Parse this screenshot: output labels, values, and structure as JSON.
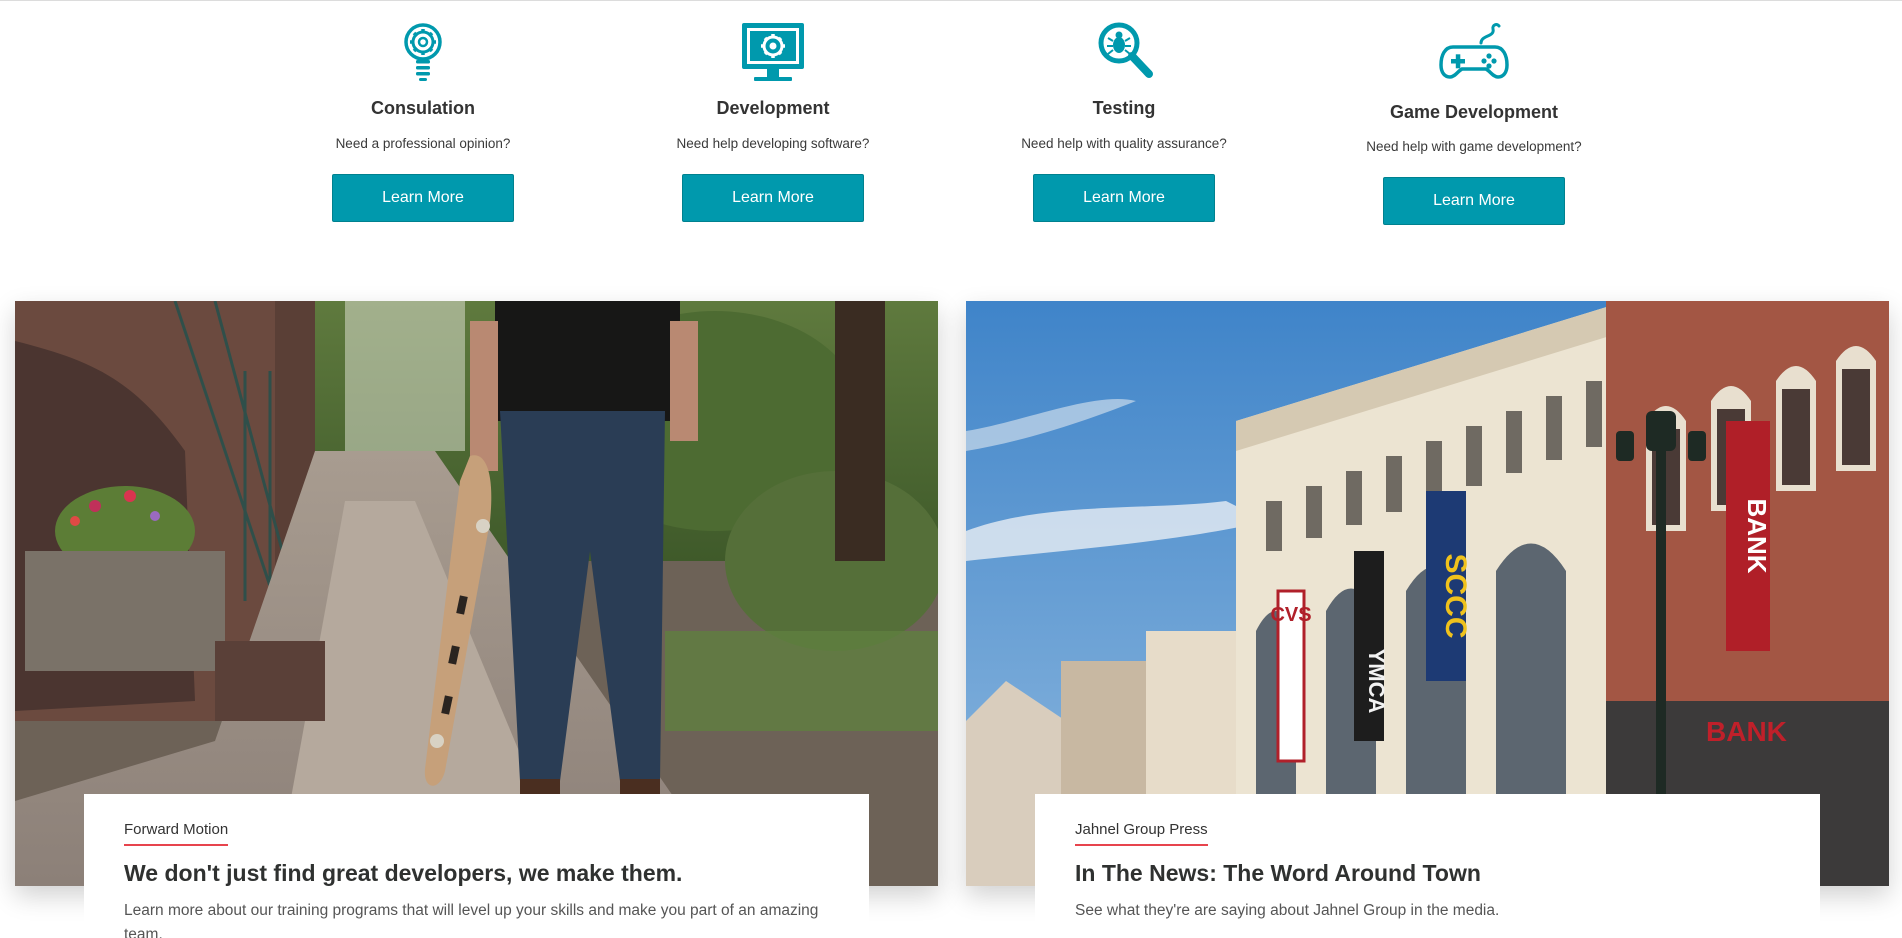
{
  "services": [
    {
      "title": "Consulation",
      "description": "Need a professional opinion?",
      "button": "Learn More",
      "icon": "lightbulb-gear-icon"
    },
    {
      "title": "Development",
      "description": "Need help developing software?",
      "button": "Learn More",
      "icon": "monitor-gear-icon"
    },
    {
      "title": "Testing",
      "description": "Need help with quality assurance?",
      "button": "Learn More",
      "icon": "magnifier-bug-icon"
    },
    {
      "title": "Game Development",
      "description": "Need help with game development?",
      "button": "Learn More",
      "icon": "gamepad-icon"
    }
  ],
  "features": [
    {
      "kicker": "Forward Motion",
      "title": "We don't just find great developers, we make them.",
      "description": "Learn more about our training programs that will level up your skills and make you part of an amazing team.",
      "image": "person-holding-skateboard-on-sidewalk"
    },
    {
      "kicker": "Jahnel Group Press",
      "title": "In The News: The Word Around Town",
      "description": "See what they're are saying about Jahnel Group in the media.",
      "image": "historic-downtown-storefronts",
      "signs": {
        "vertical_1": "CVS",
        "vertical_2": "YMCA",
        "vertical_3": "SCCC",
        "bank": "BANK"
      }
    }
  ],
  "colors": {
    "accent": "#0099ad",
    "underline": "#e7444d",
    "heading": "#2f3130"
  }
}
